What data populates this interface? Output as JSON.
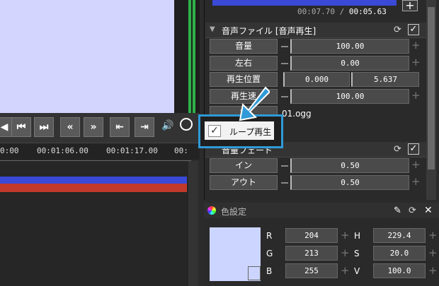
{
  "timeline": {
    "ticks": [
      "0:00",
      "00:01:06.00",
      "00:01:17.00",
      "00:"
    ]
  },
  "transport": {
    "buttons": [
      "prev-frame",
      "play",
      "rewind",
      "fast-forward",
      "go-start",
      "go-end"
    ],
    "volume_icon": "speaker-icon",
    "zoom_icon": "zoom-in-icon"
  },
  "sidepanel": {
    "time_current": "00:07.70",
    "time_sep": " / ",
    "time_total": "00:05.63"
  },
  "audio_section": {
    "title": "音声ファイル [音声再生]",
    "rows": [
      {
        "label": "音量",
        "value": "100.00"
      },
      {
        "label": "左右",
        "value": "0.00"
      },
      {
        "label": "再生位置",
        "value": "0.000",
        "value2": "5.637"
      },
      {
        "label": "再生速",
        "value": "100.00"
      },
      {
        "label": "フ",
        "file": "01.ogg"
      }
    ]
  },
  "fade_section": {
    "title": "音量フェード",
    "rows": [
      {
        "label": "イン",
        "value": "0.50"
      },
      {
        "label": "アウト",
        "value": "0.50"
      }
    ]
  },
  "popup": {
    "label": "ループ再生",
    "checked": true
  },
  "color_panel": {
    "title": "色設定",
    "rgb": [
      {
        "label": "R",
        "value": "204"
      },
      {
        "label": "G",
        "value": "213"
      },
      {
        "label": "B",
        "value": "255"
      }
    ],
    "hsv": [
      {
        "label": "H",
        "value": "229.4"
      },
      {
        "label": "S",
        "value": "20.0"
      },
      {
        "label": "V",
        "value": "100.0"
      }
    ],
    "swatch_color": "#ccd5ff"
  },
  "colors": {
    "accent_blue": "#2f9ad8",
    "audio_wave": "#3a49d6",
    "audio_red": "#c0392b",
    "meter_green": "#2fb24a"
  }
}
